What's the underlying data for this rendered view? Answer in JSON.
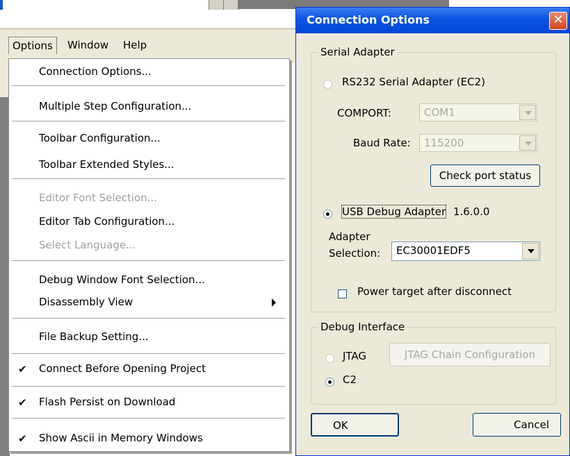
{
  "menubar": {
    "options": "Options",
    "window": "Window",
    "help": "Help"
  },
  "menu": {
    "items": [
      {
        "label": "Connection Options...",
        "enabled": true,
        "checked": false
      },
      {
        "label": "Multiple Step Configuration...",
        "enabled": true,
        "checked": false
      },
      {
        "label": "Toolbar Configuration...",
        "enabled": true,
        "checked": false
      },
      {
        "label": "Toolbar Extended Styles...",
        "enabled": true,
        "checked": false
      },
      {
        "label": "Editor Font Selection...",
        "enabled": false,
        "checked": false
      },
      {
        "label": "Editor Tab Configuration...",
        "enabled": true,
        "checked": false
      },
      {
        "label": "Select Language...",
        "enabled": false,
        "checked": false
      },
      {
        "label": "Debug Window Font Selection...",
        "enabled": true,
        "checked": false
      },
      {
        "label": "Disassembly View",
        "enabled": true,
        "checked": false,
        "submenu": true
      },
      {
        "label": "File Backup Setting...",
        "enabled": true,
        "checked": false
      },
      {
        "label": "Connect Before Opening Project",
        "enabled": true,
        "checked": true
      },
      {
        "label": "Flash Persist on Download",
        "enabled": true,
        "checked": true
      },
      {
        "label": "Show Ascii in Memory Windows",
        "enabled": true,
        "checked": true
      }
    ],
    "check_glyph": "✔"
  },
  "dialog": {
    "title": "Connection Options",
    "close_glyph": "✕",
    "serial_adapter": {
      "group_title": "Serial Adapter",
      "rs232_label": "RS232 Serial Adapter (EC2)",
      "comport_label": "COMPORT:",
      "comport_value": "COM1",
      "baud_label": "Baud Rate:",
      "baud_value": "115200",
      "check_port_button": "Check port status",
      "usb_label": "USB Debug Adapter",
      "usb_version": "1.6.0.0",
      "adapter_selection_label_1": "Adapter",
      "adapter_selection_label_2": "Selection:",
      "adapter_selection_value": "EC30001EDF5",
      "power_target_label": "Power target after disconnect",
      "power_target_checked": false,
      "selected": "usb"
    },
    "debug_interface": {
      "group_title": "Debug Interface",
      "jtag_label": "JTAG",
      "jtag_chain_button": "JTAG Chain Configuration",
      "c2_label": "C2",
      "selected": "c2"
    },
    "ok_button": "OK",
    "cancel_button": "Cancel"
  },
  "colors": {
    "titlebar": "#0a54e3",
    "dialog_bg": "#ece9d8",
    "close_button": "#d2461f"
  }
}
